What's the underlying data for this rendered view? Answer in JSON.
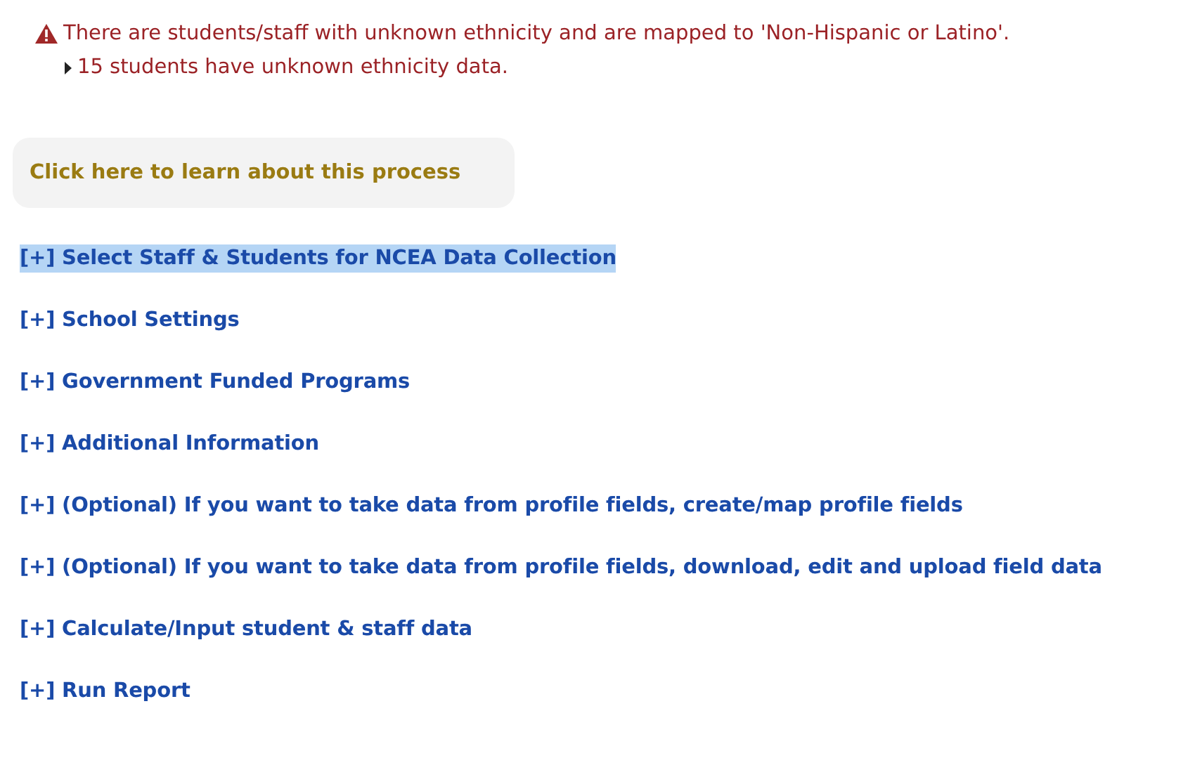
{
  "warning": {
    "message": "There are students/staff with unknown ethnicity and are mapped to 'Non-Hispanic or Latino'.",
    "details": [
      "15 students have unknown ethnicity data."
    ]
  },
  "learn_link": "Click here to learn about this process",
  "sections": [
    {
      "label": "[+] Select Staff & Students for NCEA Data Collection",
      "selected": true
    },
    {
      "label": "[+] School Settings",
      "selected": false
    },
    {
      "label": "[+] Government Funded Programs",
      "selected": false
    },
    {
      "label": "[+] Additional Information",
      "selected": false
    },
    {
      "label": "[+] (Optional) If you want to take data from profile fields, create/map profile fields",
      "selected": false
    },
    {
      "label": "[+] (Optional) If you want to take data from profile fields, download, edit and upload field data",
      "selected": false
    },
    {
      "label": "[+] Calculate/Input student & staff data",
      "selected": false
    },
    {
      "label": "[+] Run Report",
      "selected": false
    }
  ]
}
